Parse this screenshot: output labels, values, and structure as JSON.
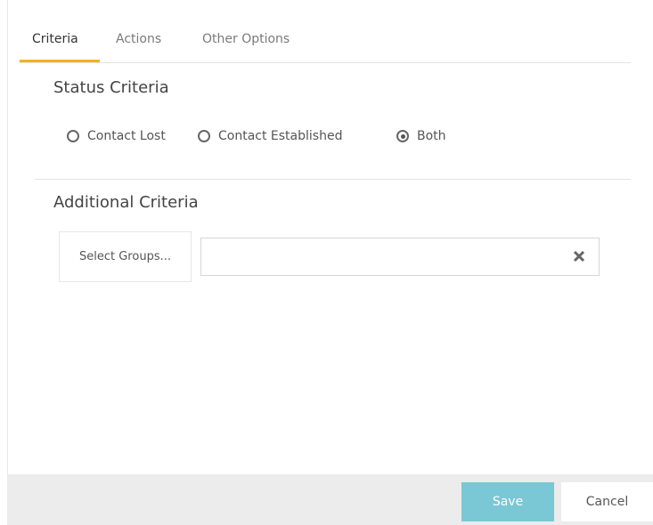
{
  "tabs": [
    {
      "label": "Criteria",
      "active": true
    },
    {
      "label": "Actions",
      "active": false
    },
    {
      "label": "Other Options",
      "active": false
    }
  ],
  "status_criteria": {
    "title": "Status Criteria",
    "options": [
      {
        "label": "Contact Lost",
        "selected": false
      },
      {
        "label": "Contact Established",
        "selected": false
      },
      {
        "label": "Both",
        "selected": true
      }
    ]
  },
  "additional_criteria": {
    "title": "Additional Criteria",
    "select_groups_label": "Select Groups...",
    "groups_value": "",
    "clear_icon": "close-icon"
  },
  "footer": {
    "save_label": "Save",
    "cancel_label": "Cancel"
  },
  "colors": {
    "tab_accent": "#f0b323",
    "save_button": "#7ac7d5",
    "footer_background": "#ececec"
  }
}
